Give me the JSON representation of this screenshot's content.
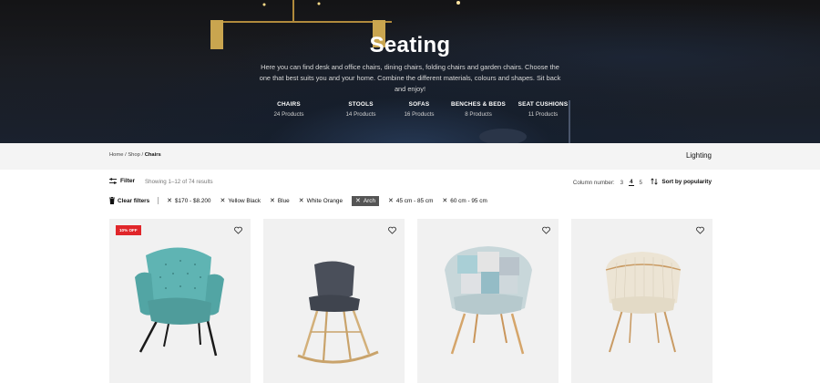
{
  "hero": {
    "title": "Seating",
    "description": "Here you can find desk and office chairs, dining chairs, folding chairs and garden chairs. Choose the one that best suits you and your home. Combine the different materials, colours and shapes. Sit back and enjoy!",
    "categories": [
      {
        "name": "CHAIRS",
        "count": "24 Products"
      },
      {
        "name": "STOOLS",
        "count": "14 Products"
      },
      {
        "name": "SOFAS",
        "count": "16 Products"
      },
      {
        "name": "BENCHES & BEDS",
        "count": "8 Products"
      },
      {
        "name": "SEAT CUSHIONS",
        "count": "11 Products"
      }
    ]
  },
  "breadcrumb": {
    "home": "Home",
    "shop": "Shop",
    "current": "Chairs",
    "sep": " / "
  },
  "next_category": "Lighting",
  "toolbar": {
    "filter_label": "Filter",
    "results_text": "Showing 1–12 of 74 results",
    "column_label": "Column number:",
    "columns": [
      "3",
      "4",
      "5"
    ],
    "active_column": "4",
    "sort_label": "Sort by popularity"
  },
  "filters": {
    "clear_label": "Clear filters",
    "chips": [
      {
        "label": "$170 - $8.200",
        "active": false
      },
      {
        "label": "Yellow Black",
        "active": false
      },
      {
        "label": "Blue",
        "active": false
      },
      {
        "label": "White Orange",
        "active": false
      },
      {
        "label": "Arch",
        "active": true
      },
      {
        "label": "45 cm - 85 cm",
        "active": false
      },
      {
        "label": "60 cm - 95 cm",
        "active": false
      }
    ]
  },
  "products": [
    {
      "badge": "10% OFF",
      "color": "#5fb4b3"
    },
    {
      "badge": "",
      "color": "#4a4f5a"
    },
    {
      "badge": "",
      "color": "#aeccd1"
    },
    {
      "badge": "",
      "color": "#ece4d4"
    }
  ],
  "colors": {
    "accent": "#e0262a",
    "chip_active": "#555555"
  }
}
